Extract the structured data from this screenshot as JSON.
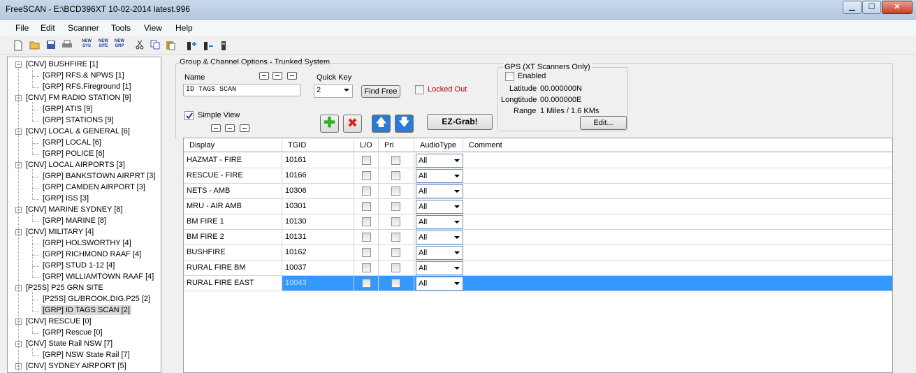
{
  "window": {
    "title": "FreeSCAN - E:\\BCD396XT 10-02-2014 latest.996",
    "min_label": "▁",
    "max_label": "☐",
    "close_label": "✕"
  },
  "menu": [
    "File",
    "Edit",
    "Scanner",
    "Tools",
    "View",
    "Help"
  ],
  "toolbar": {
    "new_sys": "NEW SYS",
    "new_site": "NEW SITE",
    "new_grp": "NEW GRP"
  },
  "tree": [
    {
      "label": "[CNV] BUSHFIRE [1]",
      "level": 0
    },
    {
      "label": "[GRP] RFS.& NPWS [1]",
      "level": 1
    },
    {
      "label": "[GRP] RFS.Fireground [1]",
      "level": 1
    },
    {
      "label": "[CNV] FM RADIO STATION [9]",
      "level": 0
    },
    {
      "label": "[GRP] ATIS [9]",
      "level": 1
    },
    {
      "label": "[GRP] STATIONS [9]",
      "level": 1
    },
    {
      "label": "[CNV] LOCAL & GENERAL [6]",
      "level": 0
    },
    {
      "label": "[GRP] LOCAL [6]",
      "level": 1
    },
    {
      "label": "[GRP] POLICE [6]",
      "level": 1
    },
    {
      "label": "[CNV] LOCAL AIRPORTS [3]",
      "level": 0
    },
    {
      "label": "[GRP] BANKSTOWN AIRPRT [3]",
      "level": 1
    },
    {
      "label": "[GRP] CAMDEN AIRPORT [3]",
      "level": 1
    },
    {
      "label": "[GRP] ISS [3]",
      "level": 1
    },
    {
      "label": "[CNV] MARINE SYDNEY [8]",
      "level": 0
    },
    {
      "label": "[GRP] MARINE [8]",
      "level": 1
    },
    {
      "label": "[CNV] MILITARY [4]",
      "level": 0
    },
    {
      "label": "[GRP] HOLSWORTHY [4]",
      "level": 1
    },
    {
      "label": "[GRP] RICHMOND RAAF [4]",
      "level": 1
    },
    {
      "label": "[GRP] STUD 1-12 [4]",
      "level": 1
    },
    {
      "label": "[GRP] WILLIAMTOWN RAAF [4]",
      "level": 1
    },
    {
      "label": "[P25S] P25 GRN SITE",
      "level": 0
    },
    {
      "label": "[P25S] GL/BROOK.DIG.P25 [2]",
      "level": 1
    },
    {
      "label": "[GRP] ID TAGS SCAN [2]",
      "level": 1,
      "selected": true
    },
    {
      "label": "[CNV] RESCUE [0]",
      "level": 0
    },
    {
      "label": "[GRP] Rescue [0]",
      "level": 1
    },
    {
      "label": "[CNV] State Rail NSW [7]",
      "level": 0
    },
    {
      "label": "[GRP] NSW State Rail [7]",
      "level": 1
    },
    {
      "label": "[CNV] SYDNEY AIRPORT [5]",
      "level": 0
    }
  ],
  "panel": {
    "title": "Group & Channel Options - Trunked System",
    "name_label": "Name",
    "name_value": "ID TAGS SCAN",
    "quick_key_label": "Quick Key",
    "quick_key_value": "2",
    "find_free": "Find Free",
    "locked_out": "Locked Out",
    "simple_view": "Simple View",
    "ez_grab": "EZ-Grab!",
    "add_icon": "✚",
    "delete_icon": "✖",
    "up_icon": "🡅",
    "down_icon": "🡇"
  },
  "gps": {
    "title": "GPS (XT Scanners Only)",
    "enabled": "Enabled",
    "latitude_label": "Latitude",
    "latitude_value": "00.000000N",
    "longitude_label": "Longtitude",
    "longitude_value": "00.000000E",
    "range_label": "Range",
    "range_value": "1 Miles / 1.6 KMs",
    "edit": "Edit..."
  },
  "grid": {
    "columns": [
      "Display",
      "TGID",
      "L/O",
      "Pri",
      "AudioType",
      "Comment"
    ],
    "rows": [
      {
        "display": "HAZMAT - FIRE",
        "tgid": "10161",
        "audio": "All"
      },
      {
        "display": "RESCUE - FIRE",
        "tgid": "10166",
        "audio": "All"
      },
      {
        "display": "NETS - AMB",
        "tgid": "10306",
        "audio": "All"
      },
      {
        "display": "MRU - AIR AMB",
        "tgid": "10301",
        "audio": "All"
      },
      {
        "display": "BM FIRE 1",
        "tgid": "10130",
        "audio": "All"
      },
      {
        "display": "BM FIRE 2",
        "tgid": "10131",
        "audio": "All"
      },
      {
        "display": "BUSHFIRE",
        "tgid": "10162",
        "audio": "All"
      },
      {
        "display": "RURAL FIRE BM",
        "tgid": "10037",
        "audio": "All"
      },
      {
        "display": "RURAL FIRE EAST",
        "tgid": "10043",
        "audio": "All",
        "selected": true
      }
    ]
  }
}
